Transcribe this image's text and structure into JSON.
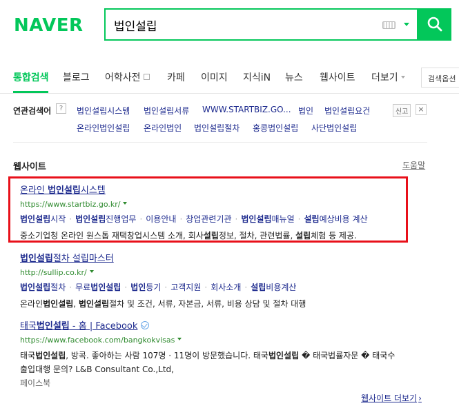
{
  "header": {
    "logo": "NAVER",
    "query": "법인설립"
  },
  "tabs": [
    "통합검색",
    "블로그",
    "어학사전",
    "카페",
    "이미지",
    "지식iN",
    "뉴스",
    "웹사이트",
    "더보기"
  ],
  "search_options": "검색옵션",
  "related": {
    "title": "연관검색어",
    "help": "?",
    "row1": [
      "법인설립시스템",
      "법인설립서류",
      "WWW.STARTBIZ.GO...",
      "법인",
      "법인설립요건"
    ],
    "row2": [
      "온라인법인설립",
      "온라인법인",
      "법인설립절차",
      "홍콩법인설립",
      "사단법인설립"
    ],
    "report": "신고",
    "close": "×"
  },
  "website_section": {
    "title": "웹사이트",
    "help": "도움말",
    "results": [
      {
        "title_pre": "온라인 ",
        "title_bold": "법인설립",
        "title_post": "시스템",
        "url": "https://www.startbiz.go.kr/",
        "links": [
          {
            "bold": "법인설립",
            "rest": "시작"
          },
          {
            "bold": "법인설립",
            "rest": "진행업무"
          },
          {
            "bold": "",
            "rest": "이용안내"
          },
          {
            "bold": "",
            "rest": "창업관련기관"
          },
          {
            "bold": "법인설립",
            "rest": "매뉴얼"
          },
          {
            "bold": "설립",
            "rest": "예상비용 계산"
          }
        ],
        "desc": [
          {
            "t": "중소기업청 온라인 원스톱 재택창업시스템 소개, 회사",
            "b": false
          },
          {
            "t": "설립",
            "b": true
          },
          {
            "t": "정보, 절차, 관련법률, ",
            "b": false
          },
          {
            "t": "설립",
            "b": true
          },
          {
            "t": "체험 등 제공.",
            "b": false
          }
        ]
      },
      {
        "title_pre": "",
        "title_bold": "법인설립",
        "title_post": "절차 설립마스터",
        "url": "http://sullip.co.kr/",
        "links": [
          {
            "bold": "법인설립",
            "rest": "절차"
          },
          {
            "pre": "무료",
            "bold": "법인설립",
            "rest": ""
          },
          {
            "bold": "법인",
            "rest": "등기"
          },
          {
            "bold": "",
            "rest": "고객지원"
          },
          {
            "bold": "",
            "rest": "회사소개"
          },
          {
            "bold": "설립",
            "rest": "비용계산"
          }
        ],
        "desc": [
          {
            "t": "온라인",
            "b": false
          },
          {
            "t": "법인설립",
            "b": true
          },
          {
            "t": ", ",
            "b": false
          },
          {
            "t": "법인설립",
            "b": true
          },
          {
            "t": "절차 및 조건, 서류, 자본금, 서류, 비용 상담 및 절차 대행",
            "b": false
          }
        ]
      },
      {
        "title_pre": "태국",
        "title_bold": "법인설립",
        "title_post": " - 홈 | Facebook",
        "url": "https://www.facebook.com/bangkokvisas",
        "desc_line1": [
          {
            "t": "태국",
            "b": false
          },
          {
            "t": "법인설립",
            "b": true
          },
          {
            "t": ", 방콕. 좋아하는 사람 107명 · 11명이 방문했습니다. 태국",
            "b": false
          },
          {
            "t": "법인설립",
            "b": true
          },
          {
            "t": " � 태국법률자문 � 태국수",
            "b": false
          }
        ],
        "desc_line2": "출입대행 문의? L&B Consultant Co.,Ltd,",
        "source": "페이스북"
      }
    ],
    "more": "웹사이트 더보기"
  },
  "colors": {
    "brand": "#03c75a",
    "link": "#1d2a8e",
    "url": "#2e8a2e",
    "highlight": "#e8101a"
  }
}
